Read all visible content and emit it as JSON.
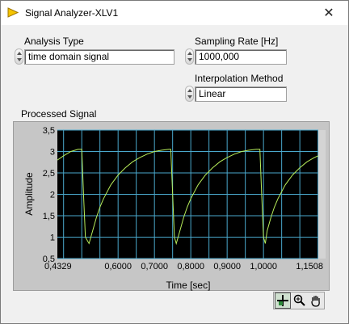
{
  "window": {
    "title": "Signal Analyzer-XLV1",
    "close_glyph": "✕"
  },
  "controls": {
    "analysis_type": {
      "label": "Analysis Type",
      "value": "time domain signal"
    },
    "sampling_rate": {
      "label": "Sampling Rate [Hz]",
      "value": "1000,000"
    },
    "interpolation": {
      "label": "Interpolation Method",
      "value": "Linear"
    }
  },
  "graph": {
    "label": "Processed Signal"
  },
  "palette": {
    "icons": [
      "cursor-crosshair-icon",
      "zoom-icon",
      "pan-hand-icon"
    ]
  },
  "colors": {
    "plot_bg": "#000000",
    "grid": "#4aa8cc",
    "trace": "#b8ee5a",
    "frame": "#c6c6c6"
  },
  "chart_data": {
    "type": "line",
    "title": "",
    "xlabel": "Time [sec]",
    "ylabel": "Amplitude",
    "xlim": [
      0.4329,
      1.1508
    ],
    "ylim": [
      0.5,
      3.5
    ],
    "x_tick_labels": [
      "0,4329",
      "0,6000",
      "0,7000",
      "0,8000",
      "0,9000",
      "1,0000",
      "1,1508"
    ],
    "x_tick_values": [
      0.4329,
      0.6,
      0.7,
      0.8,
      0.9,
      1.0,
      1.1508
    ],
    "y_tick_labels": [
      "0,5",
      "1",
      "1,5",
      "2",
      "2,5",
      "3",
      "3,5"
    ],
    "y_tick_values": [
      0.5,
      1,
      1.5,
      2,
      2.5,
      3,
      3.5
    ],
    "grid": true,
    "series": [
      {
        "x": [
          0.4329,
          0.45,
          0.47,
          0.49,
          0.5,
          0.505,
          0.51,
          0.52,
          0.53,
          0.54,
          0.55,
          0.56,
          0.58,
          0.6,
          0.62,
          0.64,
          0.66,
          0.68,
          0.7,
          0.72,
          0.74,
          0.745,
          0.75,
          0.755,
          0.76,
          0.77,
          0.78,
          0.79,
          0.8,
          0.82,
          0.84,
          0.86,
          0.88,
          0.9,
          0.92,
          0.94,
          0.96,
          0.98,
          0.99,
          0.995,
          1.0,
          1.005,
          1.01,
          1.02,
          1.03,
          1.04,
          1.06,
          1.08,
          1.1,
          1.12,
          1.14,
          1.1508
        ],
        "y": [
          2.8,
          2.9,
          3.0,
          3.05,
          3.05,
          2.0,
          1.0,
          0.85,
          1.15,
          1.45,
          1.7,
          1.9,
          2.22,
          2.45,
          2.62,
          2.76,
          2.86,
          2.94,
          3.0,
          3.03,
          3.05,
          3.05,
          2.0,
          1.0,
          0.85,
          1.15,
          1.45,
          1.7,
          1.9,
          2.22,
          2.45,
          2.62,
          2.76,
          2.86,
          2.94,
          3.0,
          3.03,
          3.05,
          3.05,
          2.0,
          1.0,
          0.85,
          1.15,
          1.45,
          1.7,
          1.9,
          2.22,
          2.45,
          2.62,
          2.76,
          2.86,
          2.9
        ]
      }
    ]
  }
}
